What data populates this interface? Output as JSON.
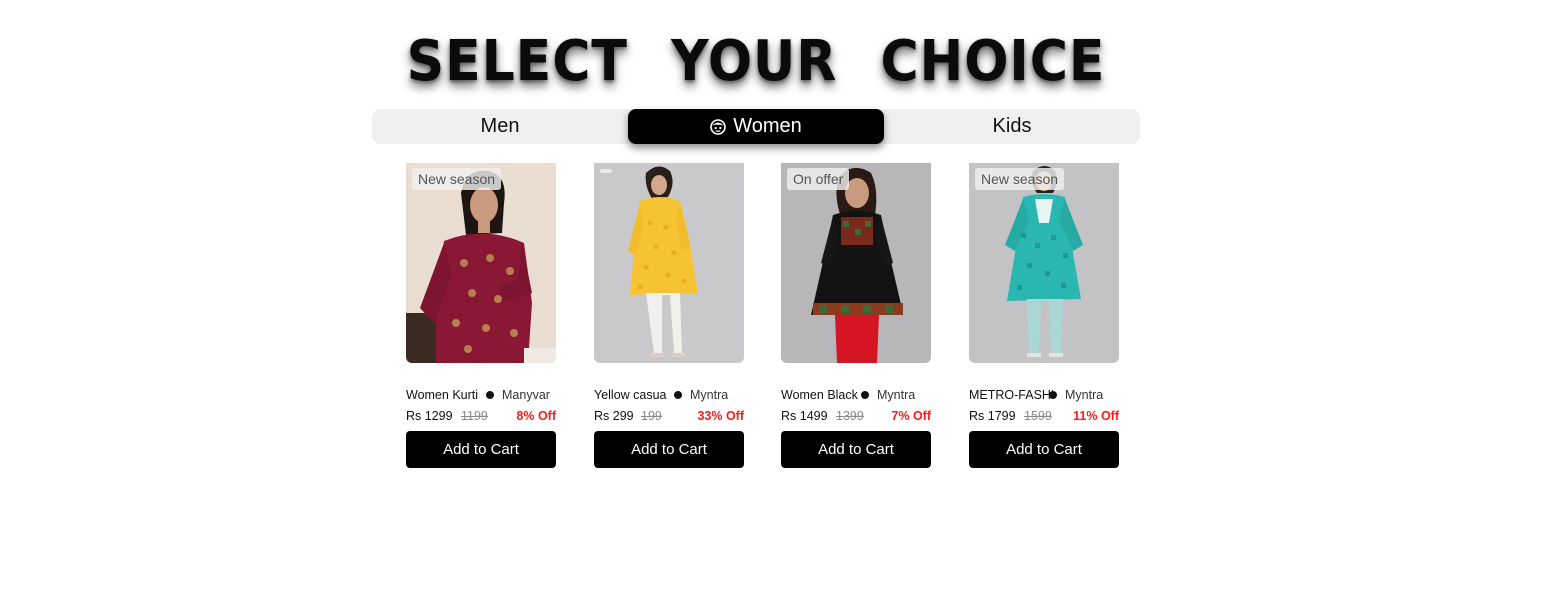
{
  "header": {
    "title": "SELECT YOUR CHOICE"
  },
  "tabs": [
    {
      "label": "Men",
      "active": false
    },
    {
      "label": "Women",
      "active": true,
      "icon": "woman-face-icon"
    },
    {
      "label": "Kids",
      "active": false
    }
  ],
  "products": [
    {
      "badge": "New season",
      "name": "Women Kurti",
      "brand": "Manyvar",
      "price": "Rs 1299",
      "mrp": "1199",
      "discount": "8% Off",
      "button": "Add to Cart",
      "image": "maroon-printed-kurti-photo"
    },
    {
      "badge": "",
      "name": "Yellow casua",
      "brand": "Myntra",
      "price": "Rs 299",
      "mrp": "199",
      "discount": "33% Off",
      "button": "Add to Cart",
      "image": "yellow-casual-kurta-photo"
    },
    {
      "badge": "On offer",
      "name": "Women Black",
      "brand": "Myntra",
      "price": "Rs 1499",
      "mrp": "1399",
      "discount": "7% Off",
      "button": "Add to Cart",
      "image": "black-embroidered-kurti-photo"
    },
    {
      "badge": "New season",
      "name": "METRO-FASHI",
      "brand": "Myntra",
      "price": "Rs 1799",
      "mrp": "1599",
      "discount": "11% Off",
      "button": "Add to Cart",
      "image": "teal-kurta-set-photo"
    }
  ],
  "colors": {
    "accent": "#000000",
    "discount": "#ff1a1a",
    "tab_bg": "#f0f0f0",
    "mrp": "#8a8a8a"
  }
}
